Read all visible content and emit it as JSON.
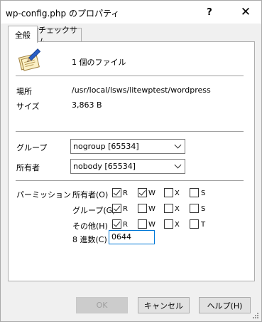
{
  "window": {
    "title": "wp-config.php のプロパティ",
    "help_glyph": "?",
    "close_glyph": "✕"
  },
  "tabs": [
    {
      "label": "全般",
      "active": true
    },
    {
      "label": "チェックサム",
      "active": false
    }
  ],
  "file_info": {
    "icon": "files-with-pen-icon",
    "count_label": "1 個のファイル",
    "location_label": "場所",
    "location_value": "/usr/local/lsws/litewptest/wordpress",
    "size_label": "サイズ",
    "size_value": "3,863 B"
  },
  "ownership": {
    "group_label": "グループ",
    "group_value": "nogroup [65534]",
    "owner_label": "所有者",
    "owner_value": "nobody [65534]"
  },
  "permissions": {
    "section_label": "パーミッション",
    "rows": [
      {
        "label": "所有者(O)",
        "R": true,
        "W": true,
        "X": false,
        "S": false,
        "special": "S"
      },
      {
        "label": "グループ(G)",
        "R": true,
        "W": false,
        "X": false,
        "S": false,
        "special": "S"
      },
      {
        "label": "その他(H)",
        "R": true,
        "W": false,
        "X": false,
        "S": false,
        "special": "T"
      }
    ],
    "letters": {
      "r": "R",
      "w": "W",
      "x": "X"
    },
    "octal_label": "8 進数(C)",
    "octal_value": "0644"
  },
  "buttons": {
    "ok": "OK",
    "cancel": "キャンセル",
    "help": "ヘルプ(H)"
  }
}
